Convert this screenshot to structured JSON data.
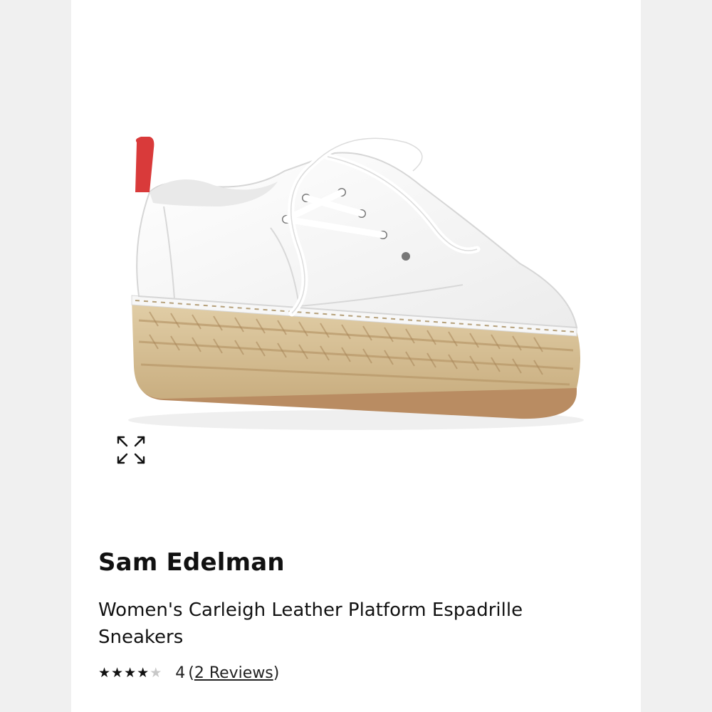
{
  "product": {
    "brand": "Sam Edelman",
    "name": "Women's Carleigh Leather Platform Espadrille Sneakers",
    "rating": {
      "stars_filled": 4,
      "stars_total": 5,
      "value": "4",
      "open_paren": "(",
      "reviews_label": "2 Reviews",
      "close_paren": ")"
    }
  },
  "icons": {
    "expand": "expand-icon",
    "star": "star-icon"
  },
  "colors": {
    "background": "#ffffff",
    "text": "#111111",
    "star_filled": "#111111",
    "star_empty": "#c8c8c8",
    "heel_tab": "#d93a3a"
  }
}
